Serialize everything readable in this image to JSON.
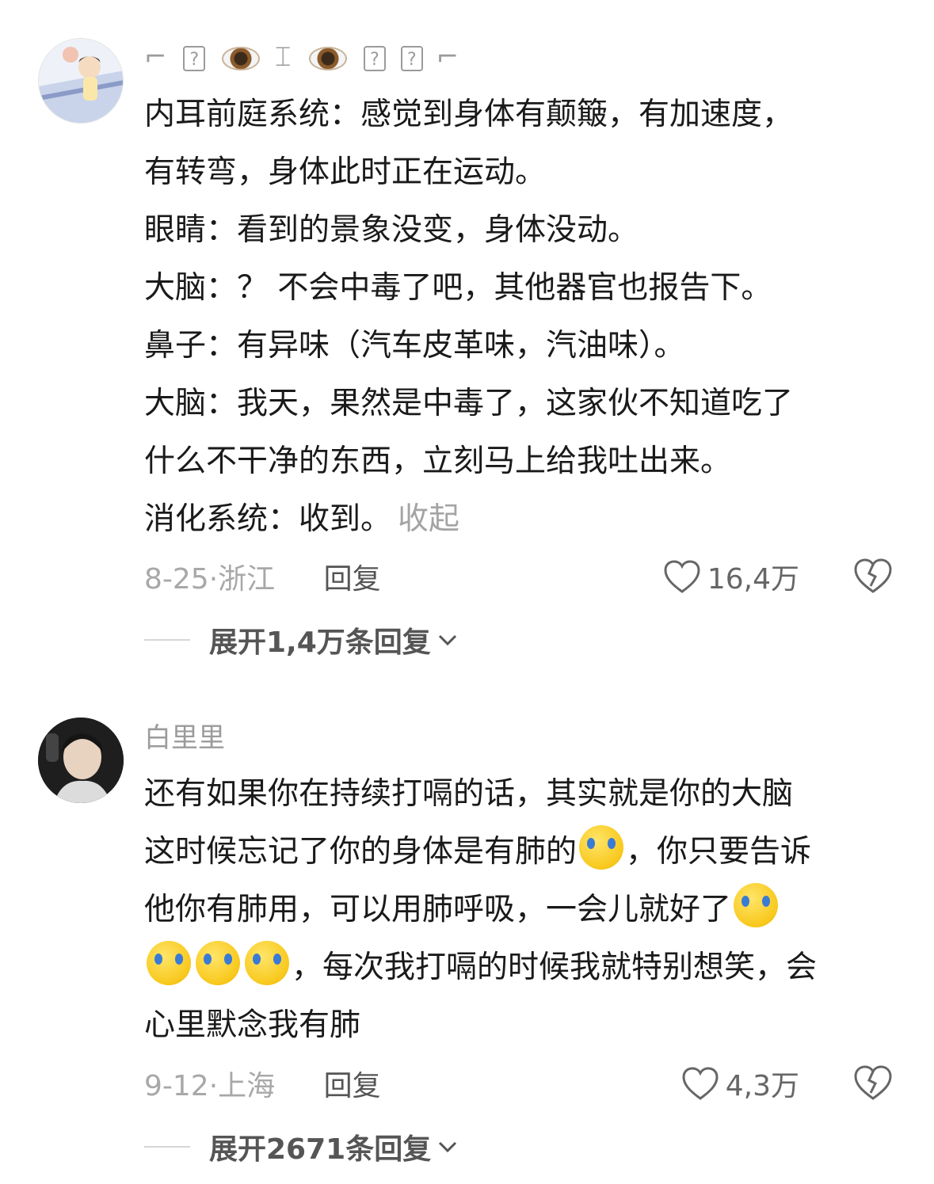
{
  "comments": [
    {
      "username_parts": [
        "⌐",
        "?",
        "eye",
        "⌶",
        "eye",
        "?",
        "?",
        "⌐"
      ],
      "lines": [
        "内耳前庭系统：感觉到身体有颠簸，有加速度，",
        "有转弯，身体此时正在运动。",
        "眼睛：看到的景象没变，身体没动。",
        "大脑：？ 不会中毒了吧，其他器官也报告下。",
        "鼻子：有异味（汽车皮革味，汽油味）。",
        "大脑：我天，果然是中毒了，这家伙不知道吃了",
        "什么不干净的东西，立刻马上给我吐出来。",
        "消化系统：收到。"
      ],
      "collapse_label": "收起",
      "date_location": "8-25·浙江",
      "reply_label": "回复",
      "likes": "16,4万",
      "expand_label": "展开1,4万条回复"
    },
    {
      "username": "白里里",
      "lines": [
        "还有如果你在持续打嗝的话，其实就是你的大脑",
        "这时候忘记了你的身体是有肺的",
        "，你只要告诉",
        "他你有肺用，可以用肺呼吸，一会儿就好了",
        "，每次我打嗝的时候我就特别想笑，会",
        "心里默念我有肺"
      ],
      "date_location": "9-12·上海",
      "reply_label": "回复",
      "likes": "4,3万",
      "expand_label": "展开2671条回复"
    }
  ],
  "icons": {
    "like": "heart-icon",
    "dislike": "broken-heart-icon",
    "emoji": "loudly-crying-face-icon",
    "expand": "chevron-down-icon"
  }
}
